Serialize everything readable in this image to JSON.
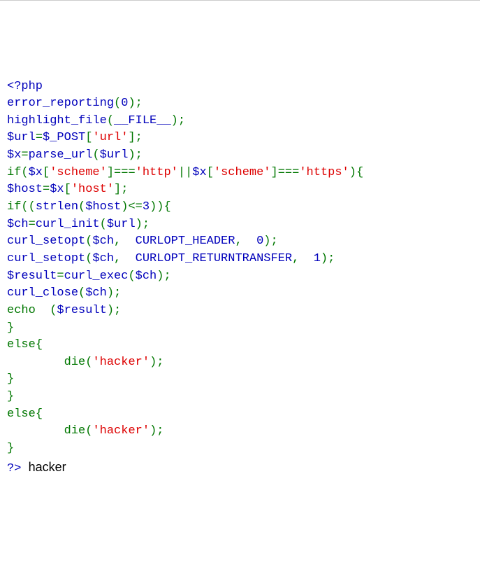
{
  "code": {
    "open": "<?php",
    "fn_error": "error_reporting",
    "zero": "0",
    "fn_highlight": "highlight_file",
    "file_c": "__FILE__",
    "url_v": "$url",
    "post_v": "$_POST",
    "s_url": "'url'",
    "x_v": "$x",
    "fn_parse": "parse_url",
    "kw_if": "if",
    "s_scheme": "'scheme'",
    "s_http": "'http'",
    "s_https": "'https'",
    "host_v": "$host",
    "s_host": "'host'",
    "fn_strlen": "strlen",
    "three": "3",
    "ch_v": "$ch",
    "fn_cinit": "curl_init",
    "fn_csetopt": "curl_setopt",
    "c_header": "CURLOPT_HEADER",
    "c_return": "CURLOPT_RETURNTRANSFER",
    "one": "1",
    "result_v": "$result",
    "fn_cexec": "curl_exec",
    "fn_cclose": "curl_close",
    "kw_echo": "echo",
    "kw_else": "else",
    "kw_die": "die",
    "s_hacker": "'hacker'",
    "close": "?>"
  },
  "output": "hacker",
  "punct": {
    "lp": "(",
    "rp": ")",
    "semi": ";",
    "eq": "=",
    "teq": "===",
    "dor": "||",
    "lb": "[",
    "rb": "]",
    "lc": "{",
    "rc": "}",
    "lte": "<=",
    "com": ","
  }
}
